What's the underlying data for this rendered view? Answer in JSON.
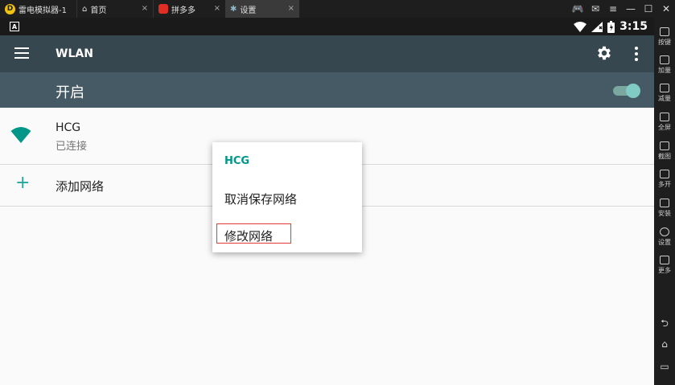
{
  "emulator": {
    "app_tab": "雷电模拟器-1",
    "tabs": [
      {
        "label": "首页"
      },
      {
        "label": "拼多多"
      },
      {
        "label": "设置"
      }
    ],
    "tab_close": "×",
    "window_controls": [
      "🎮",
      "✉",
      "≡",
      "—",
      "☐",
      "✕"
    ],
    "sidebar": [
      {
        "label": "按键",
        "icon": "keyboard-icon"
      },
      {
        "label": "加量",
        "icon": "volume-up-icon"
      },
      {
        "label": "减量",
        "icon": "volume-down-icon"
      },
      {
        "label": "全屏",
        "icon": "fullscreen-icon"
      },
      {
        "label": "截图",
        "icon": "scissors-icon"
      },
      {
        "label": "多开",
        "icon": "multi-instance-icon"
      },
      {
        "label": "安装",
        "icon": "apk-install-icon"
      },
      {
        "label": "设置",
        "icon": "gear-icon"
      },
      {
        "label": "更多",
        "icon": "more-icon"
      }
    ],
    "nav": [
      "⮌",
      "⌂",
      "▭"
    ]
  },
  "statusbar": {
    "badge": "A",
    "time": "3:15"
  },
  "appbar": {
    "title": "WLAN"
  },
  "switchbar": {
    "label": "开启",
    "on": true
  },
  "networks": [
    {
      "name": "HCG",
      "status": "已连接"
    }
  ],
  "add_network": {
    "icon_glyph": "+",
    "label": "添加网络"
  },
  "context_menu": {
    "title": "HCG",
    "items": [
      "取消保存网络",
      "修改网络"
    ]
  },
  "colors": {
    "appbar": "#37474f",
    "switchbar": "#455a64",
    "accent": "#009688",
    "highlight_box": "#e53935"
  }
}
